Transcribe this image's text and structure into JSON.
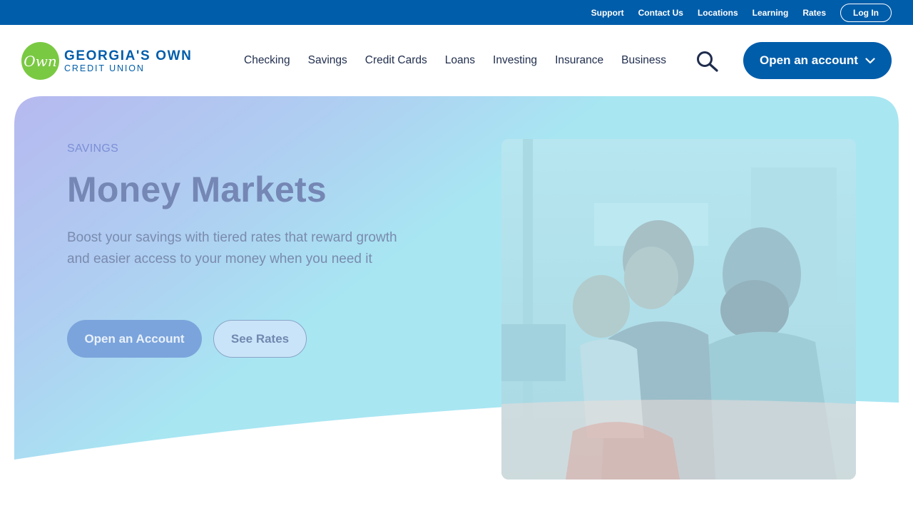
{
  "utility_nav": {
    "links": [
      "Support",
      "Contact Us",
      "Locations",
      "Learning",
      "Rates"
    ],
    "login_label": "Log In"
  },
  "header": {
    "logo": {
      "badge_text": "Own",
      "line1": "GEORGIA'S OWN",
      "line2": "CREDIT UNION"
    },
    "nav": [
      "Checking",
      "Savings",
      "Credit Cards",
      "Loans",
      "Investing",
      "Insurance",
      "Business"
    ],
    "cta_label": "Open an account"
  },
  "hero": {
    "eyebrow": "SAVINGS",
    "title": "Money Markets",
    "description": "Boost your savings with tiered rates that reward growth and easier access to your money when you need it",
    "primary_button": "Open an Account",
    "secondary_button": "See Rates"
  },
  "colors": {
    "brand_blue": "#005daa",
    "logo_green": "#7ac943",
    "nav_text": "#1f2d4d"
  }
}
